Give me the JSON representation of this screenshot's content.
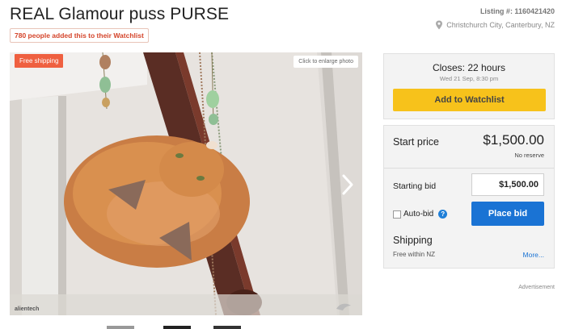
{
  "listing": {
    "title": "REAL Glamour puss PURSE",
    "watchlist_count_text": "780 people added this to their Watchlist",
    "listing_number": "Listing #: 1160421420",
    "location": "Christchurch City, Canterbury, NZ"
  },
  "photo": {
    "badge": "Free shipping",
    "enlarge": "Click to enlarge photo",
    "watermark_left": "alientech",
    "next_icon": "chevron-right-icon"
  },
  "closing": {
    "closes": "Closes: 22 hours",
    "date": "Wed 21 Sep, 8:30 pm",
    "watch_button": "Add to Watchlist"
  },
  "bidding": {
    "start_label": "Start price",
    "start_price": "$1,500.00",
    "reserve": "No reserve",
    "starting_bid_label": "Starting bid",
    "starting_bid_value": "$1,500.00",
    "autobid_label": "Auto-bid",
    "help_glyph": "?",
    "place_bid": "Place bid",
    "shipping_title": "Shipping",
    "shipping_value": "Free within NZ",
    "more": "More..."
  },
  "ad_label": "Advertisement",
  "colors": {
    "accent_orange": "#ef6040",
    "watchlist_yellow": "#f7c21b",
    "bid_blue": "#1a73d4"
  }
}
